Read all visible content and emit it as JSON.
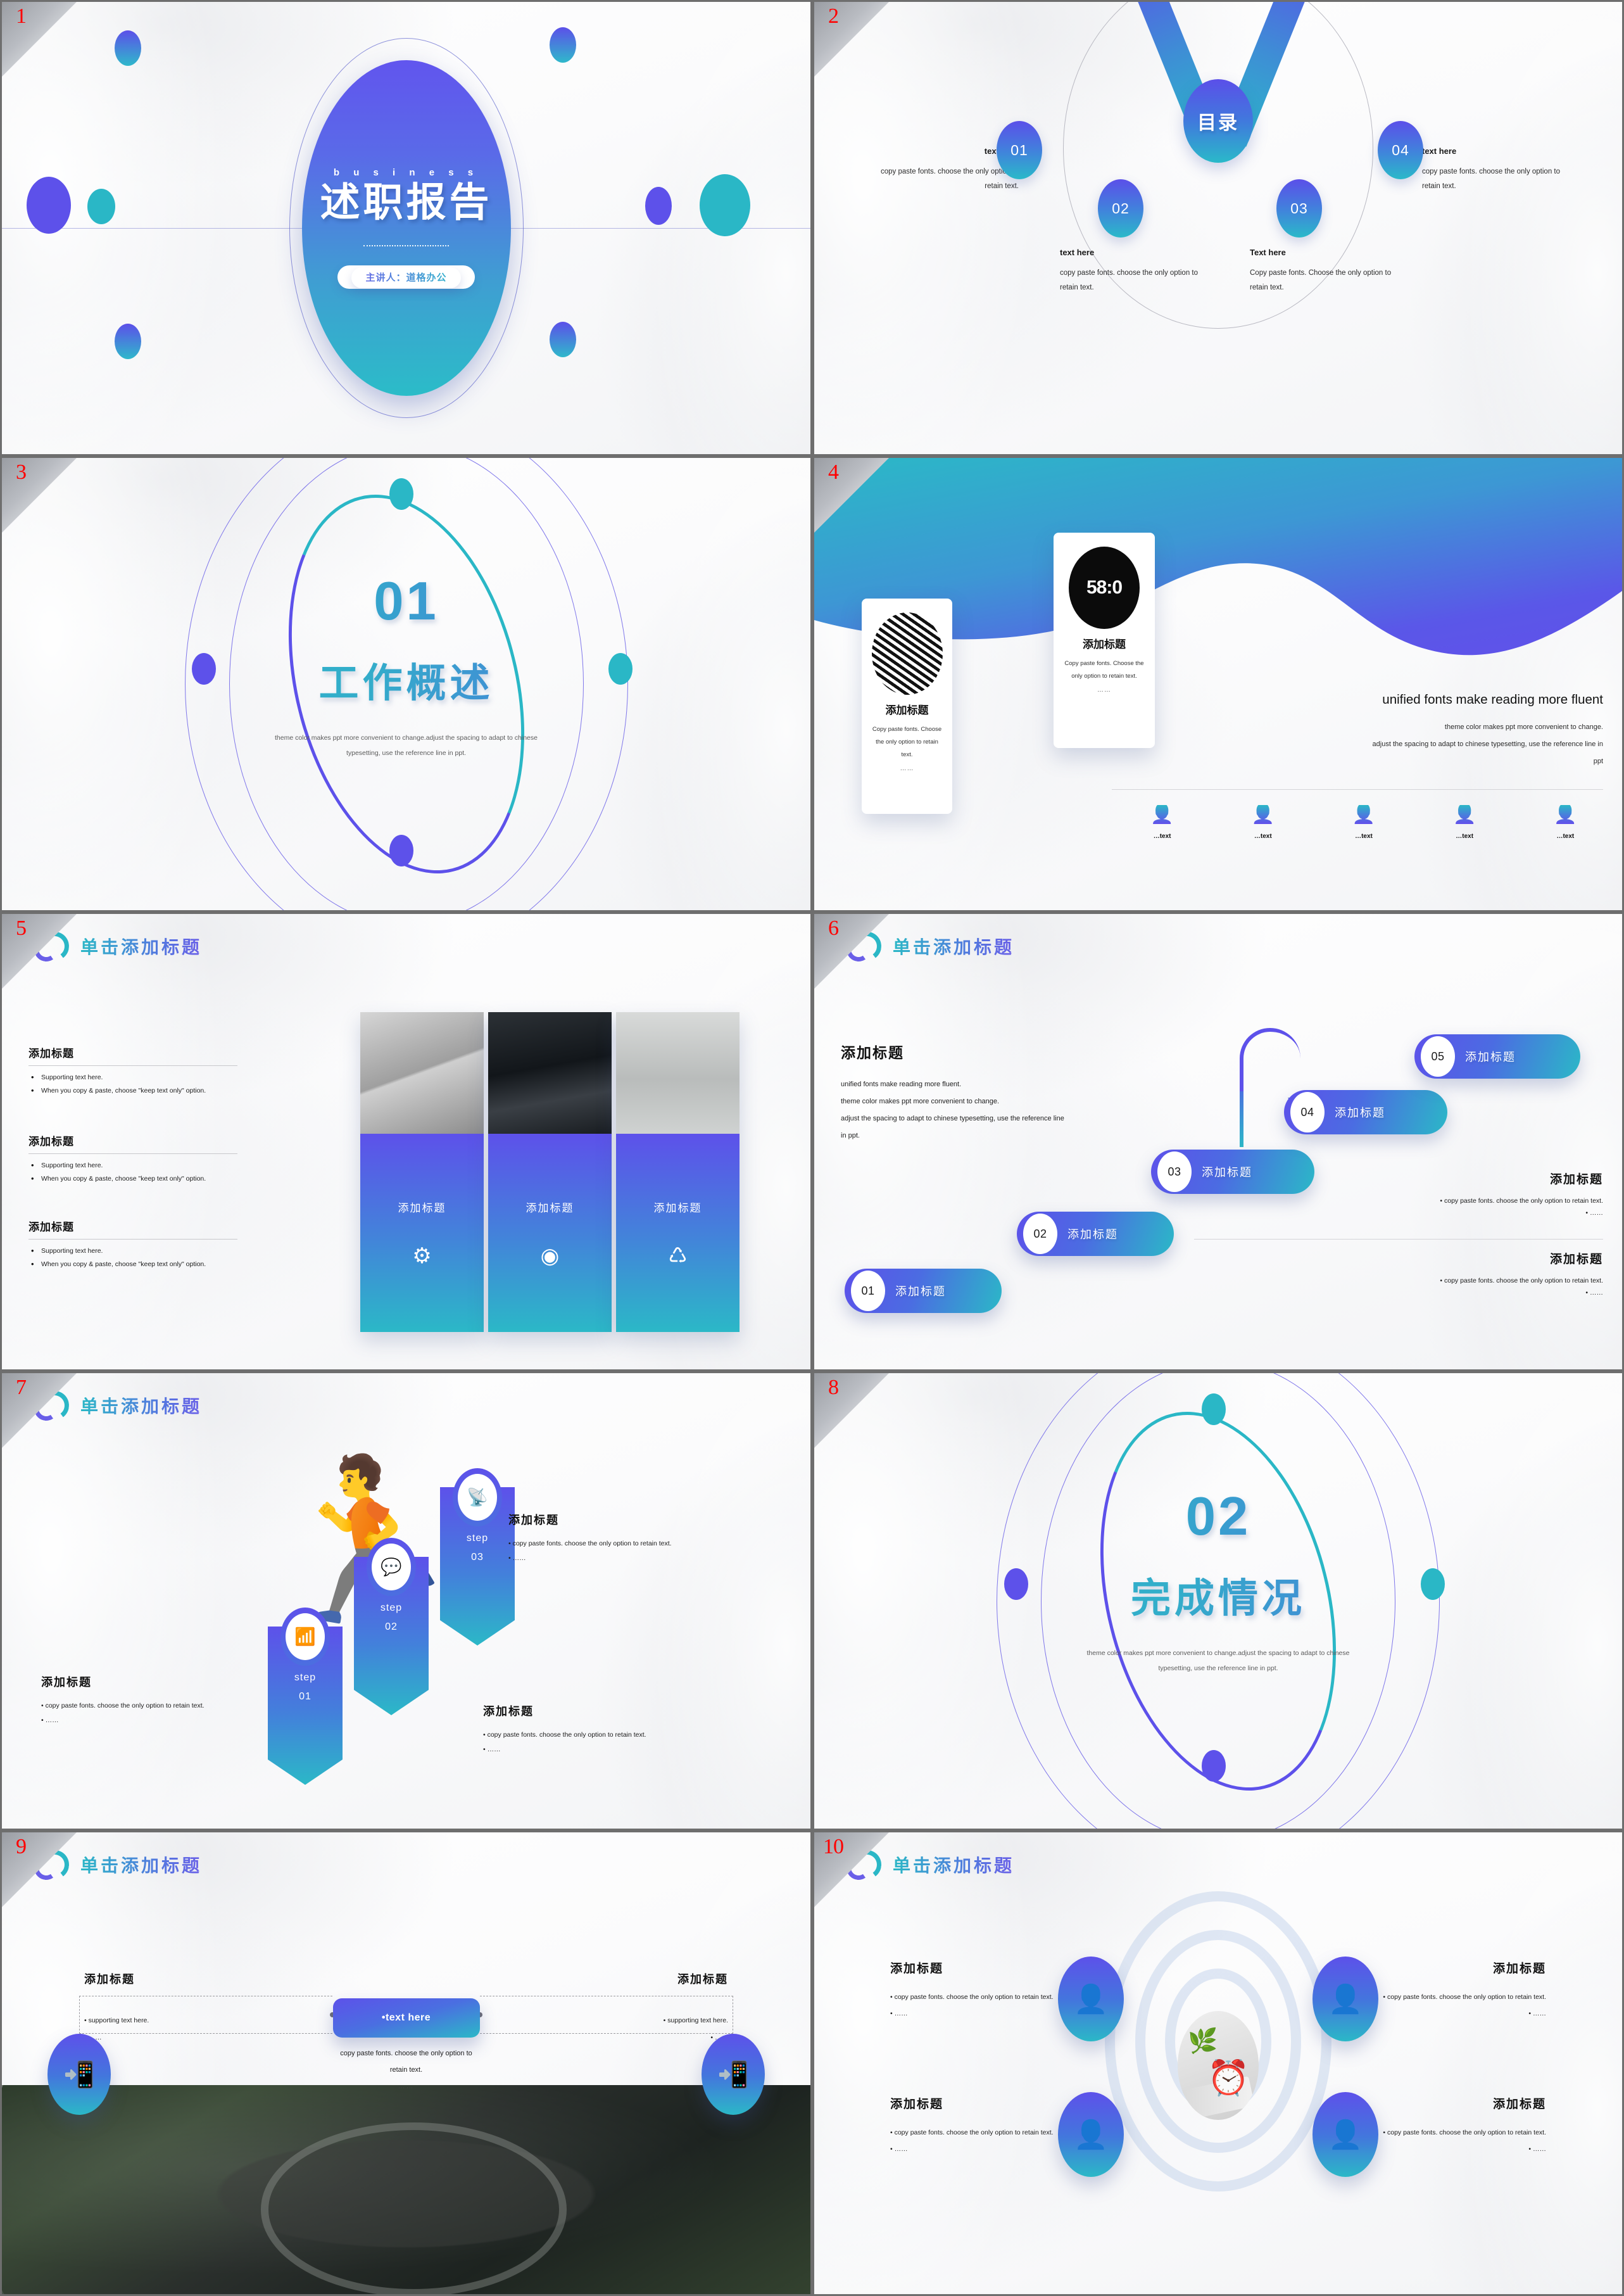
{
  "theme": {
    "purple": "#5d51ea",
    "teal": "#2bb8c7",
    "page_number_color": "#ff0000"
  },
  "slides": [
    {
      "number": "1",
      "eyebrow": "b u s i n e s s",
      "title": "述职报告",
      "speaker": "主讲人：道格办公"
    },
    {
      "number": "2",
      "center": "目录",
      "nodes": [
        "01",
        "02",
        "03",
        "04"
      ],
      "captions": [
        {
          "head": "text here",
          "body": "copy paste fonts. choose the only option to retain text."
        },
        {
          "head": "text here",
          "body": "copy paste fonts. choose the only option to retain text."
        },
        {
          "head": "Text here",
          "body": "Copy paste fonts. Choose the only option to retain text."
        },
        {
          "head": "text here",
          "body": "copy paste fonts. choose the only option to retain text."
        }
      ]
    },
    {
      "number": "3",
      "section_number": "01",
      "section_title": "工作概述",
      "desc": "theme color makes ppt more convenient to change.adjust the spacing to adapt to chinese typesetting, use the reference line in ppt."
    },
    {
      "number": "4",
      "cards": [
        {
          "title": "添加标题",
          "body": "Copy paste fonts. Choose the only option to retain text.",
          "dots": "……",
          "image": "striped-abstract-photo"
        },
        {
          "title": "添加标题",
          "body": "Copy paste fonts. Choose the only option to retain text.",
          "dots": "……",
          "image": "clock-58-07-photo",
          "image_label": "58:0"
        }
      ],
      "right_title": "unified fonts make reading more fluent",
      "right_body_1": "theme color makes ppt more convenient to change.",
      "right_body_2": "adjust the spacing to adapt to chinese typesetting, use the reference line in",
      "right_body_3": "ppt",
      "people": [
        "…text",
        "…text",
        "…text",
        "…text",
        "…text"
      ]
    },
    {
      "number": "5",
      "title": "单击添加标题",
      "blocks": [
        {
          "head": "添加标题",
          "items": [
            "Supporting text here.",
            "When you copy & paste, choose \"keep text only\" option."
          ]
        },
        {
          "head": "添加标题",
          "items": [
            "Supporting text here.",
            "When you copy & paste, choose \"keep text only\" option."
          ]
        },
        {
          "head": "添加标题",
          "items": [
            "Supporting text here.",
            "When you copy & paste, choose \"keep text only\" option."
          ]
        }
      ],
      "columns": [
        {
          "label": "添加标题",
          "icon": "gear-icon",
          "glyph": "⚙"
        },
        {
          "label": "添加标题",
          "icon": "aperture-icon",
          "glyph": "◉"
        },
        {
          "label": "添加标题",
          "icon": "recycle-icon",
          "glyph": "♺"
        }
      ]
    },
    {
      "number": "6",
      "title": "单击添加标题",
      "left_head": "添加标题",
      "left_lines": [
        "unified fonts make reading more fluent.",
        "theme color makes ppt more convenient to change.",
        "adjust the spacing to adapt to chinese typesetting, use the reference line",
        "in ppt."
      ],
      "steps": [
        {
          "num": "01",
          "label": "添加标题"
        },
        {
          "num": "02",
          "label": "添加标题"
        },
        {
          "num": "03",
          "label": "添加标题"
        },
        {
          "num": "04",
          "label": "添加标题"
        },
        {
          "num": "05",
          "label": "添加标题"
        }
      ],
      "right_blocks": [
        {
          "head": "添加标题",
          "items": [
            "copy paste fonts. choose the only option to retain text.",
            "……"
          ]
        },
        {
          "head": "添加标题",
          "items": [
            "copy paste fonts. choose the only option to retain text.",
            "……"
          ]
        }
      ]
    },
    {
      "number": "7",
      "title": "单击添加标题",
      "steps": [
        {
          "word": "step",
          "num": "01",
          "icon": "wifi-icon",
          "glyph": "📶"
        },
        {
          "word": "step",
          "num": "02",
          "icon": "chat-bubbles-icon",
          "glyph": "💬"
        },
        {
          "word": "step",
          "num": "03",
          "icon": "rss-icon",
          "glyph": "📡"
        }
      ],
      "texts": [
        {
          "head": "添加标题",
          "items": [
            "copy paste fonts. choose the only option to retain text.",
            "……"
          ]
        },
        {
          "head": "添加标题",
          "items": [
            "copy paste fonts. choose the only option to retain text.",
            "……"
          ]
        },
        {
          "head": "添加标题",
          "items": [
            "copy paste fonts. choose the only option to retain text.",
            "……"
          ]
        }
      ]
    },
    {
      "number": "8",
      "section_number": "02",
      "section_title": "完成情况",
      "desc": "theme color makes ppt more convenient to change.adjust the spacing to adapt to chinese typesetting, use the reference line in ppt."
    },
    {
      "number": "9",
      "title": "单击添加标题",
      "center_chip": "•text here",
      "center_sub": "copy paste fonts. choose the only option to retain text.",
      "center_dots": "……",
      "left": {
        "head": "添加标题",
        "items": [
          "supporting text here.",
          "……"
        ]
      },
      "right": {
        "head": "添加标题",
        "items": [
          "supporting text here.",
          "……"
        ]
      },
      "photo_caption": "aerial-highway-interchange-photo"
    },
    {
      "number": "10",
      "title": "单击添加标题",
      "blocks": [
        {
          "head": "添加标题",
          "items": [
            "copy paste fonts. choose the only option to retain text.",
            "……"
          ]
        },
        {
          "head": "添加标题",
          "items": [
            "copy paste fonts. choose the only option to retain text.",
            "……"
          ]
        },
        {
          "head": "添加标题",
          "items": [
            "copy paste fonts. choose the only option to retain text.",
            "……"
          ]
        },
        {
          "head": "添加标题",
          "items": [
            "copy paste fonts. choose the only option to retain text.",
            "……"
          ]
        }
      ],
      "center_image": "plant-and-alarm-clock-photo"
    }
  ]
}
